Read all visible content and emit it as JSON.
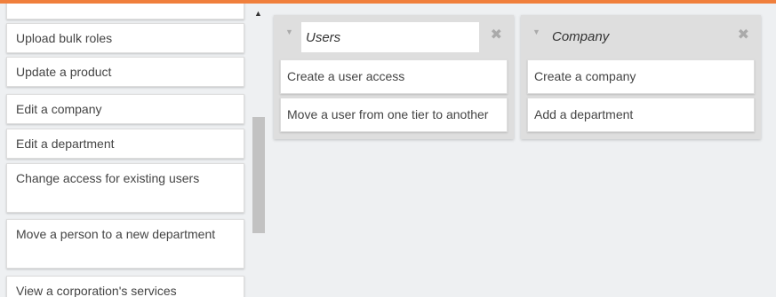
{
  "left_cards": [
    {
      "label": "Upload bulk roles"
    },
    {
      "label": "Update a product"
    },
    {
      "label": "Edit a company"
    },
    {
      "label": "Edit a department"
    },
    {
      "label": "Change access for existing users"
    },
    {
      "label": "Move a person to a new department"
    },
    {
      "label": "View a corporation's services"
    }
  ],
  "lists": [
    {
      "title": "Users",
      "cards": [
        {
          "label": "Create a user access"
        },
        {
          "label": "Move a user from one tier to another"
        }
      ]
    },
    {
      "title": "Company",
      "cards": [
        {
          "label": "Create a company"
        },
        {
          "label": "Add a department"
        }
      ]
    }
  ],
  "icons": {
    "collapse": "caret-down-icon",
    "close": "close-icon",
    "scroll_up": "triangle-up-icon"
  },
  "colors": {
    "accent": "#f07f3c"
  }
}
